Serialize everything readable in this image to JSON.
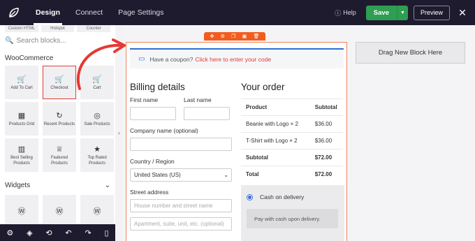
{
  "topbar": {
    "tabs": [
      "Design",
      "Connect",
      "Page Settings"
    ],
    "help": "Help",
    "save": "Save",
    "preview": "Preview"
  },
  "sidebar": {
    "top_categories": [
      "Custom HTML",
      "Hotspot",
      "Counter"
    ],
    "search_placeholder": "Search blocks...",
    "woocommerce_title": "WooCommerce",
    "woo_blocks": [
      {
        "label": "Add To Cart",
        "icon": "cart-plus-icon"
      },
      {
        "label": "Checkout",
        "icon": "cart-checkout-icon"
      },
      {
        "label": "Cart",
        "icon": "cart-icon"
      },
      {
        "label": "Products Grid",
        "icon": "grid-icon"
      },
      {
        "label": "Recent Products",
        "icon": "refresh-icon"
      },
      {
        "label": "Sale Products",
        "icon": "sale-icon"
      },
      {
        "label": "Best Selling Products",
        "icon": "bar-chart-icon"
      },
      {
        "label": "Featured Products",
        "icon": "trophy-icon"
      },
      {
        "label": "Top Rated Products",
        "icon": "star-tag-icon"
      }
    ],
    "widgets_title": "Widgets",
    "widget_blocks": [
      "wordpress-icon",
      "wordpress-icon",
      "wordpress-icon"
    ]
  },
  "coupon": {
    "text": "Have a coupon?",
    "link": "Click here to enter your code"
  },
  "billing": {
    "title": "Billing details",
    "first_name": "First name",
    "last_name": "Last name",
    "company": "Company name (optional)",
    "country_label": "Country / Region",
    "country_value": "United States (US)",
    "street_label": "Street address",
    "street_placeholder": "House number and street name",
    "street2_placeholder": "Apartment, suite, unit, etc. (optional)"
  },
  "order": {
    "title": "Your order",
    "headers": [
      "Product",
      "Subtotal"
    ],
    "rows": [
      {
        "product": "Beanie with Logo  × 2",
        "subtotal": "$36.00"
      },
      {
        "product": "T-Shirt with Logo  × 2",
        "subtotal": "$36.00"
      }
    ],
    "subtotal_label": "Subtotal",
    "subtotal_value": "$72.00",
    "total_label": "Total",
    "total_value": "$72.00"
  },
  "payment": {
    "option": "Cash on delivery",
    "description": "Pay with cash upon delivery."
  },
  "canvas": {
    "drag_block": "Drag New Block Here"
  },
  "colors": {
    "topbar": "#1f1b2e",
    "save_green": "#2e9e52",
    "block_toolbar": "#f25c1e",
    "coupon_link": "#e53935",
    "annotation_red": "#e53935"
  }
}
